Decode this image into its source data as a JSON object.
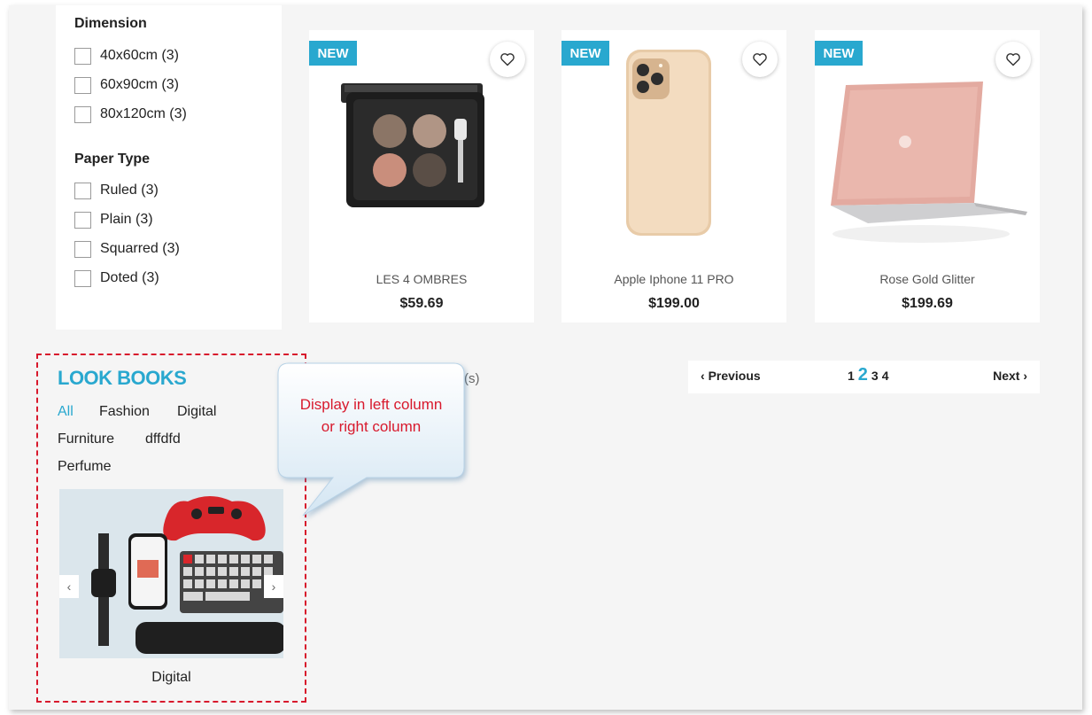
{
  "filters": {
    "groups": [
      {
        "title": "Dimension",
        "options": [
          {
            "label": "40x60cm (3)"
          },
          {
            "label": "60x90cm (3)"
          },
          {
            "label": "80x120cm (3)"
          }
        ]
      },
      {
        "title": "Paper Type",
        "options": [
          {
            "label": "Ruled (3)"
          },
          {
            "label": "Plain (3)"
          },
          {
            "label": "Squarred (3)"
          },
          {
            "label": "Doted (3)"
          }
        ]
      }
    ]
  },
  "products": [
    {
      "badge": "NEW",
      "name": "LES 4 OMBRES",
      "price": "$59.69"
    },
    {
      "badge": "NEW",
      "name": "Apple Iphone 11 PRO",
      "price": "$199.00"
    },
    {
      "badge": "NEW",
      "name": "Rose Gold Glitter",
      "price": "$199.69"
    }
  ],
  "pagination": {
    "previous_label": "Previous",
    "next_label": "Next",
    "pages": [
      "1",
      "2",
      "3",
      "4"
    ],
    "current_page": "2",
    "results_fragment": "(s)"
  },
  "lookbooks": {
    "title": "LOOK BOOKS",
    "tabs": [
      "All",
      "Fashion",
      "Digital",
      "Furniture",
      "dffdfd",
      "Perfume"
    ],
    "active_tab": "All",
    "slide_caption": "Digital"
  },
  "callout": {
    "line1": "Display in left column",
    "line2": "or right column"
  },
  "colors": {
    "accent": "#29a8cf",
    "highlight": "#d8192c",
    "background": "#f5f5f5"
  },
  "icons": {
    "wishlist": "heart-outline-icon",
    "prev": "chevron-left-icon",
    "next": "chevron-right-icon"
  }
}
